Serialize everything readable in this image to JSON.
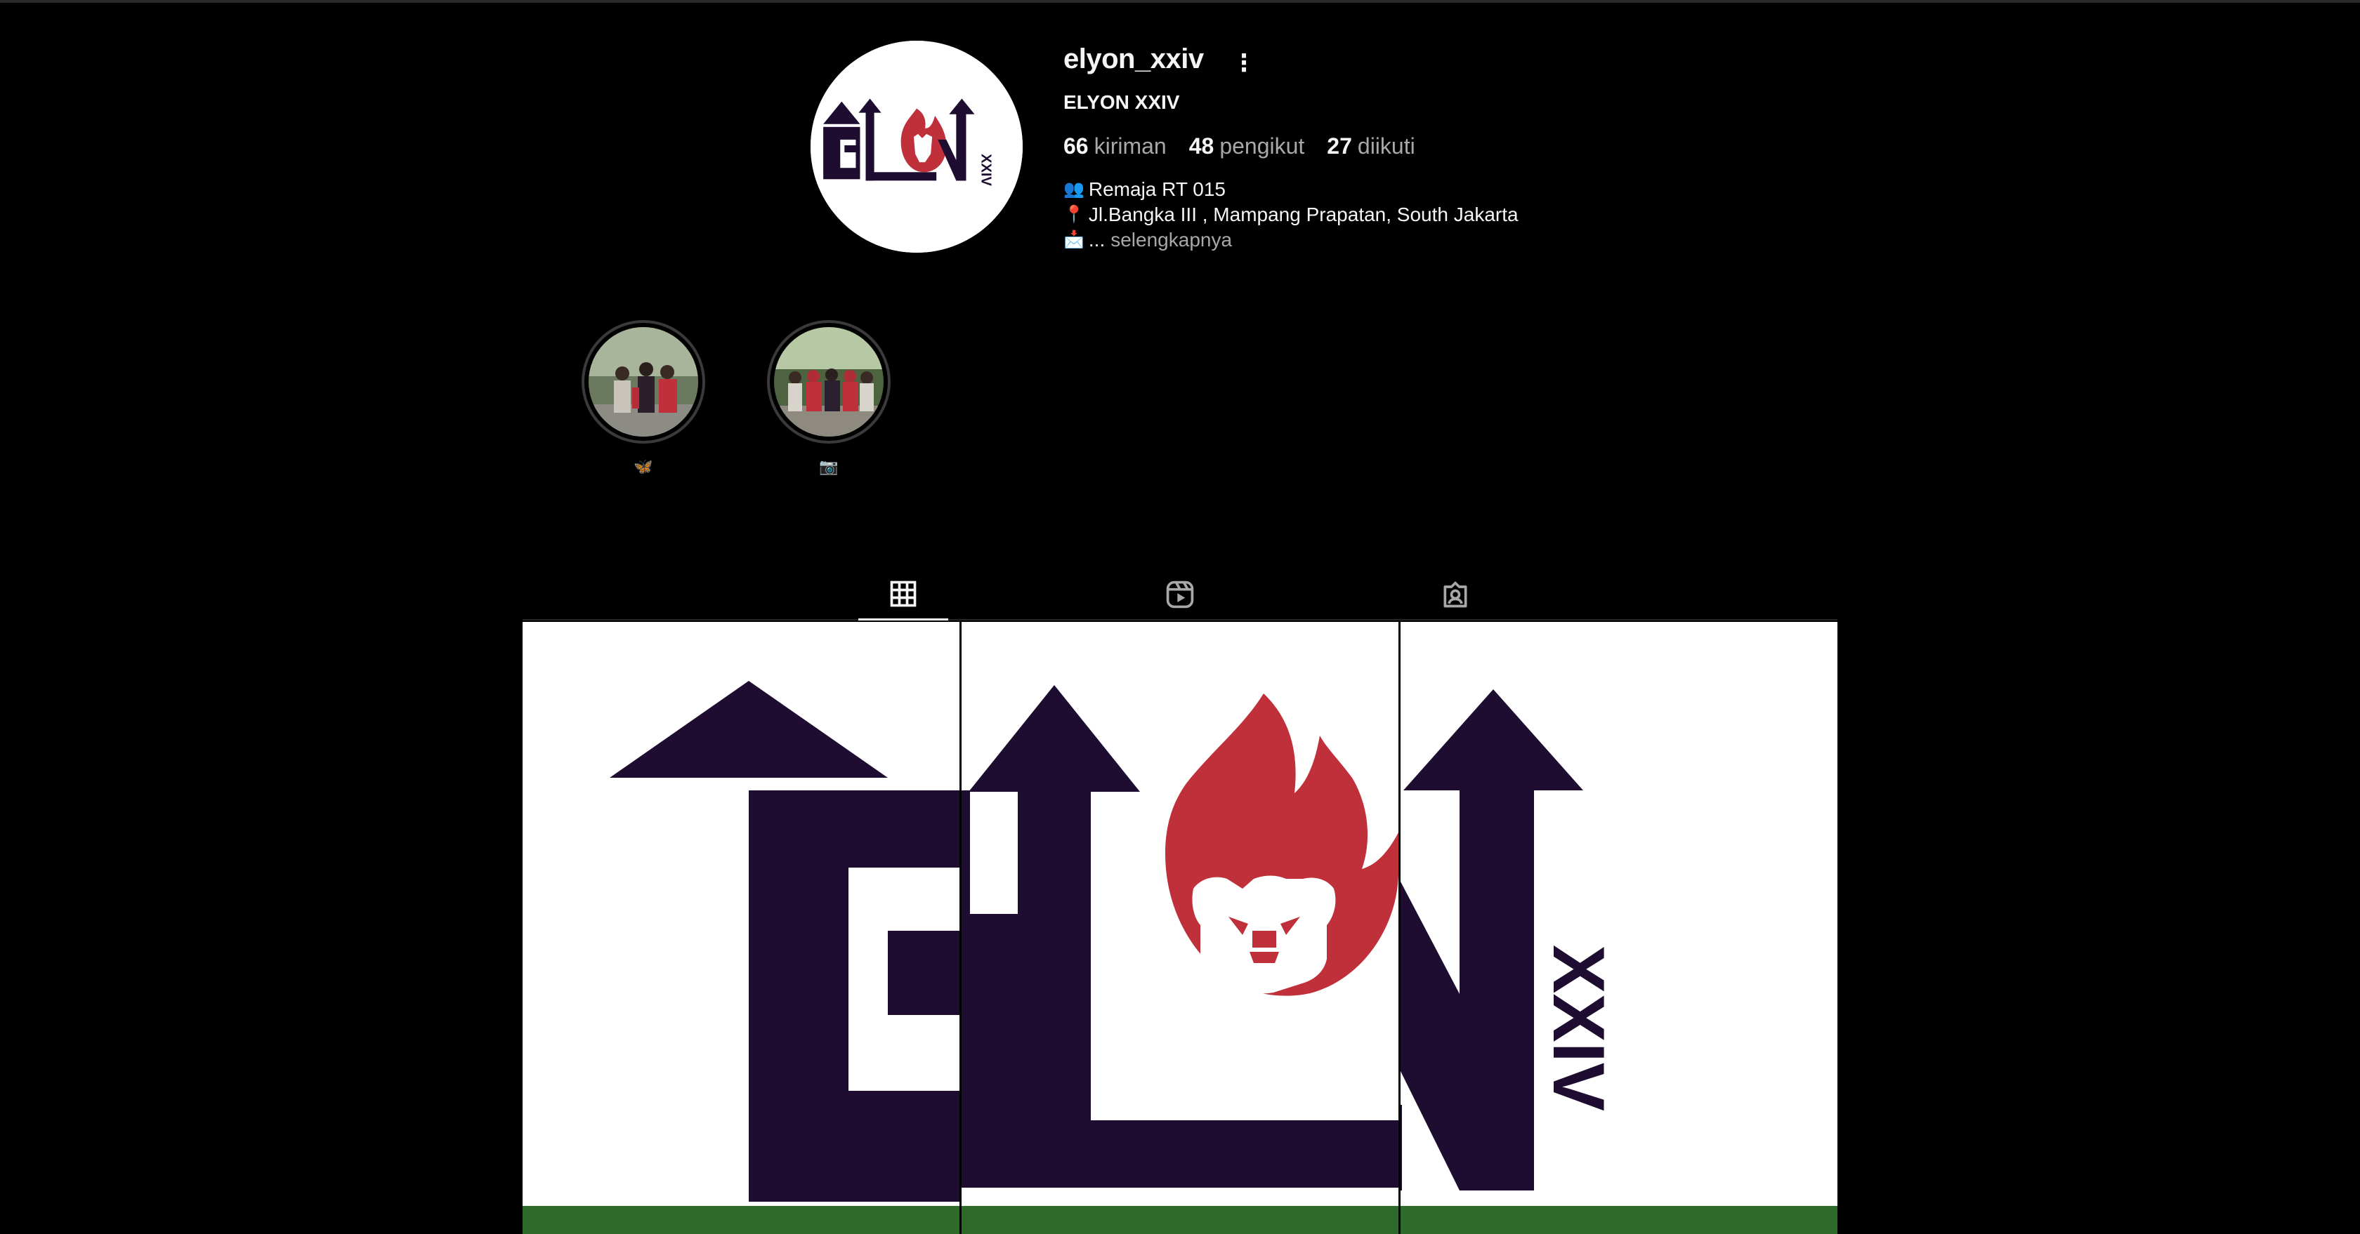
{
  "profile": {
    "username": "elyon_xxiv",
    "full_name": "ELYON XXIV",
    "avatar_logo_text": "ELYON XXIV",
    "stats": {
      "posts_count": "66",
      "posts_label": "kiriman",
      "followers_count": "48",
      "followers_label": "pengikut",
      "following_count": "27",
      "following_label": "diikuti"
    },
    "bio": {
      "line1_icon": "👥",
      "line1": "Remaja RT 015",
      "line2_icon": "📍",
      "line2": "Jl.Bangka III , Mampang Prapatan, South Jakarta",
      "line3_icon": "📩",
      "line3": "...",
      "more_label": "selengkapnya"
    }
  },
  "highlights": [
    {
      "icon": "🦋",
      "label": ""
    },
    {
      "icon": "📷",
      "label": ""
    }
  ],
  "tabs": [
    {
      "name": "posts",
      "icon": "grid-icon",
      "active": true
    },
    {
      "name": "reels",
      "icon": "reels-icon",
      "active": false
    },
    {
      "name": "tagged",
      "icon": "tagged-icon",
      "active": false
    }
  ],
  "posts_logo_text": "ELYON XXIV",
  "colors": {
    "background": "#000000",
    "text_primary": "#f5f5f5",
    "text_secondary": "#a8a8a8",
    "logo_dark": "#1e0d30",
    "logo_red": "#c0303a",
    "divider": "#262626"
  }
}
